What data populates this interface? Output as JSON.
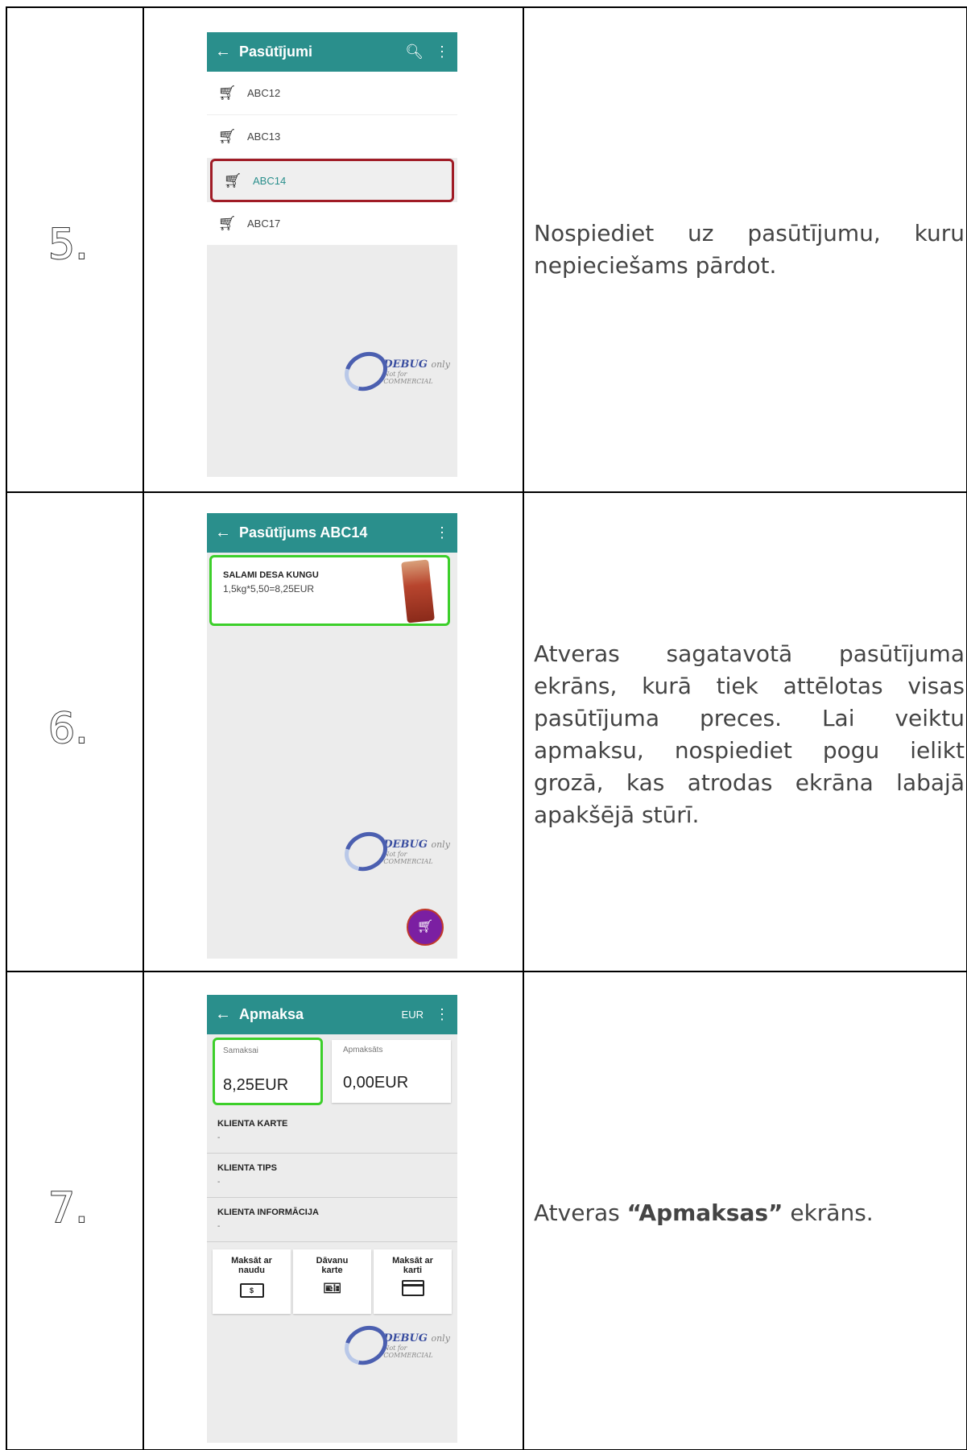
{
  "steps": [
    {
      "number": "5.",
      "description": "Nospiediet uz pasūtījumu, kuru nepieciešams pārdot.",
      "screen": {
        "title": "Pasūtījumi",
        "orders": [
          "ABC12",
          "ABC13",
          "ABC14",
          "ABC17"
        ],
        "selected": "ABC14"
      }
    },
    {
      "number": "6.",
      "description": "Atveras sagatavotā pasūtījuma ekrāns, kurā tiek attēlotas visas pasūtījuma preces. Lai veiktu apmaksu, nospiediet pogu ielikt grozā, kas atrodas ekrāna labajā apakšējā stūrī.",
      "screen": {
        "title": "Pasūtījums ABC14",
        "item_name": "SALAMI DESA KUNGU",
        "item_price": "1,5kg*5,50=8,25EUR"
      }
    },
    {
      "number": "7.",
      "description_pre": "Atveras ",
      "description_bold": "“Apmaksas”",
      "description_post": " ekrāns.",
      "screen": {
        "title": "Apmaksa",
        "currency": "EUR",
        "due_label": "Samaksai",
        "due_value": "8,25EUR",
        "paid_label": "Apmaksāts",
        "paid_value": "0,00EUR",
        "sections": [
          {
            "heading": "KLIENTA KARTE",
            "value": "-"
          },
          {
            "heading": "KLIENTA TIPS",
            "value": "-"
          },
          {
            "heading": "KLIENTA INFORMĀCIJA",
            "value": "-"
          }
        ],
        "pay_buttons": [
          {
            "line1": "Maksāt ar",
            "line2": "naudu",
            "icon": "cash-icon"
          },
          {
            "line1": "Dāvanu",
            "line2": "karte",
            "icon": "gift-card-icon"
          },
          {
            "line1": "Maksāt ar",
            "line2": "karti",
            "icon": "credit-card-icon"
          }
        ]
      }
    }
  ],
  "watermark": {
    "line1": "DEBUG",
    "line1b": "only",
    "line2": "Not for COMMERCIAL"
  },
  "colors": {
    "appbar": "#2a8f8c",
    "selected_border": "#a01c26",
    "highlight_border": "#3ccf2a",
    "fab": "#7b1fa2"
  }
}
